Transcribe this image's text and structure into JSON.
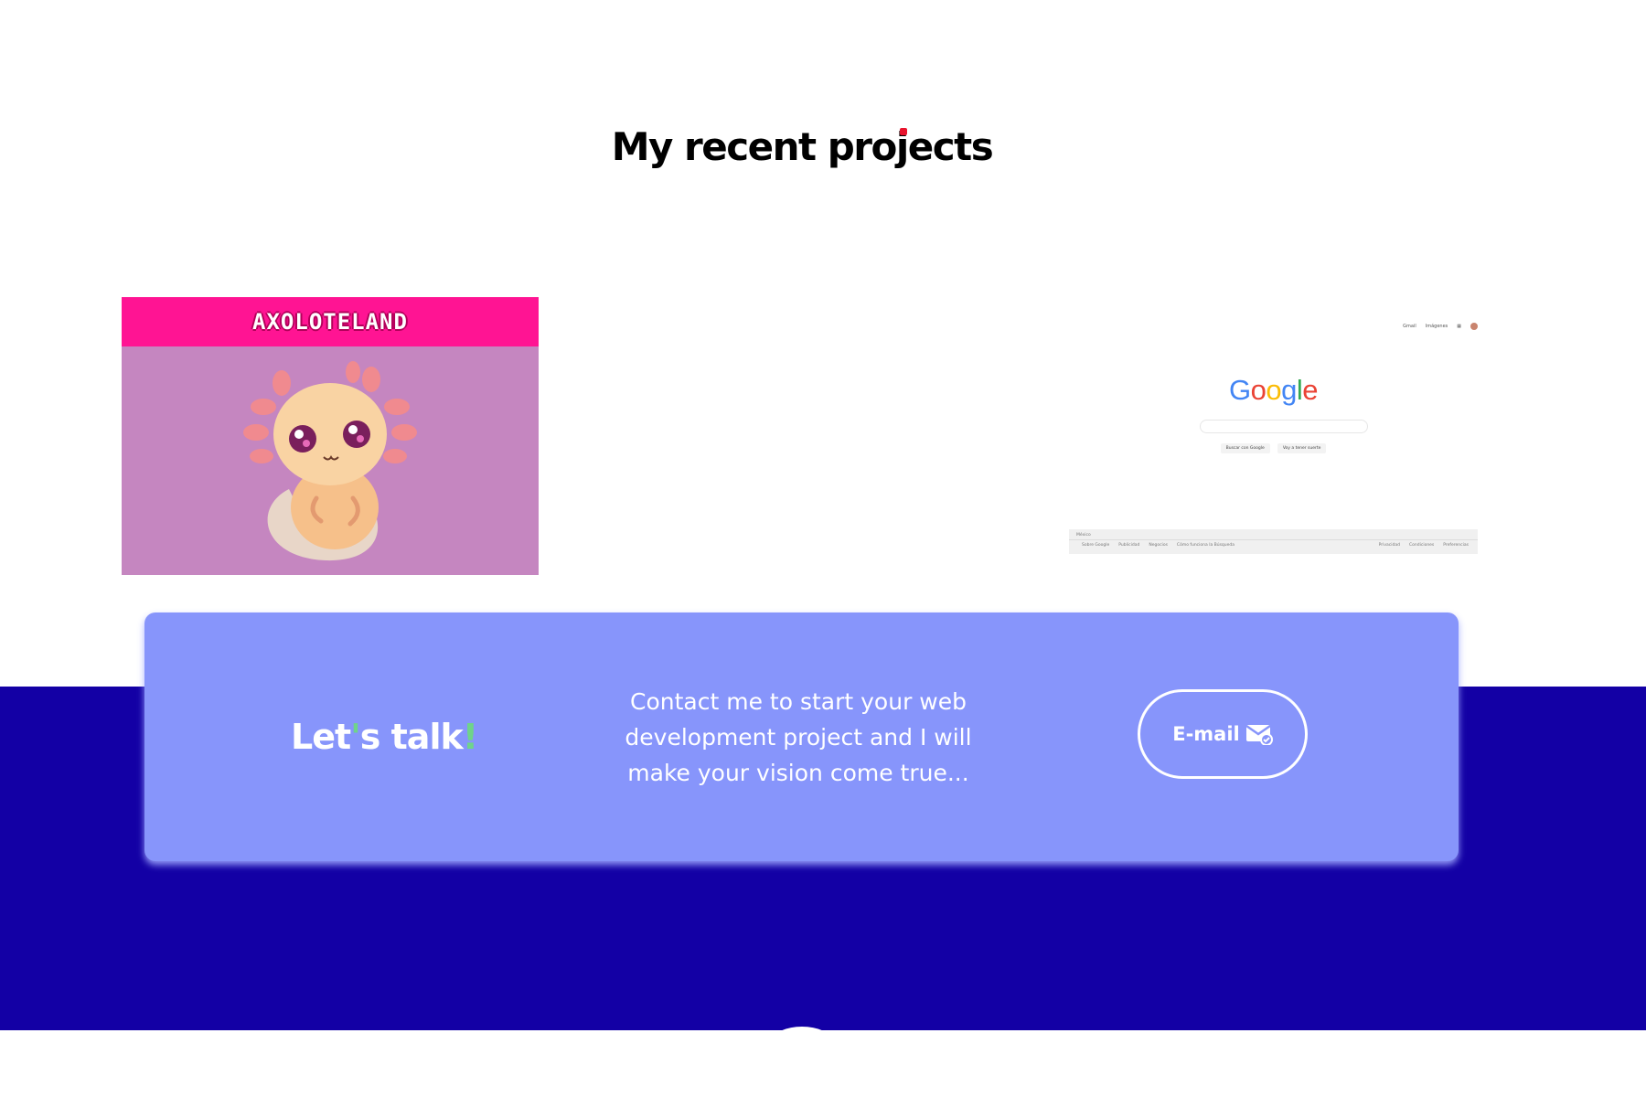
{
  "section": {
    "title_before": "My recent pro",
    "title_j": "j",
    "title_after": "ects"
  },
  "projects": [
    {
      "name": "AXOLOTELAND",
      "bg_color": "#c586c0",
      "header_color": "#ff1493"
    },
    {
      "logo": "Google",
      "top_links": [
        "Gmail",
        "Imágenes"
      ],
      "buttons": [
        "Buscar con Google",
        "Voy a tener suerte"
      ],
      "footer_country": "México",
      "footer_left": [
        "Sobre Google",
        "Publicidad",
        "Negocios",
        "Cómo funciona la Búsqueda"
      ],
      "footer_right": [
        "Privacidad",
        "Condiciones",
        "Preferencias"
      ]
    }
  ],
  "contact": {
    "heading_a": "Let",
    "heading_apos": "'",
    "heading_b": "s talk",
    "heading_excl": "!",
    "message": "Contact me to start your web development project and I will make your vision come true...",
    "button_label": "E-mail",
    "card_color": "#8795fb",
    "band_color": "#1300a5"
  }
}
